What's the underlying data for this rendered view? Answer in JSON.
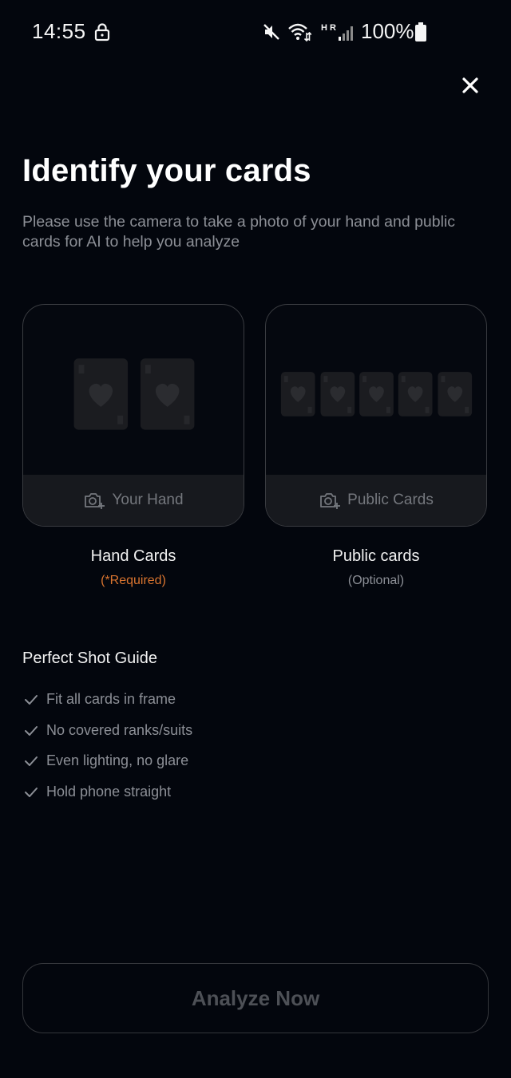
{
  "status_bar": {
    "time": "14:55",
    "network_label": "H R",
    "battery": "100%",
    "icons": [
      "lock-icon",
      "mute-icon",
      "wifi-icon",
      "signal-icon",
      "battery-icon"
    ]
  },
  "header": {
    "close_icon": "close-icon",
    "title": "Identify your cards",
    "subtitle": "Please use the camera to take a photo of your hand and public cards for AI to help you analyze"
  },
  "cards": [
    {
      "id": "hand",
      "button_label": "Your Hand",
      "caption": "Hand Cards",
      "note": "(*Required)",
      "card_count": 2
    },
    {
      "id": "public",
      "button_label": "Public Cards",
      "caption": "Public cards",
      "note": "(Optional)",
      "card_count": 5
    }
  ],
  "guide": {
    "title": "Perfect Shot Guide",
    "items": [
      "Fit all cards in frame",
      "No covered ranks/suits",
      "Even lighting, no glare",
      "Hold phone straight"
    ]
  },
  "analyze_button": {
    "label": "Analyze Now",
    "enabled": false
  },
  "colors": {
    "background": "#03060d",
    "required_accent": "#d9742f",
    "muted_text": "#8c8f96",
    "card_footer": "#17191e"
  }
}
